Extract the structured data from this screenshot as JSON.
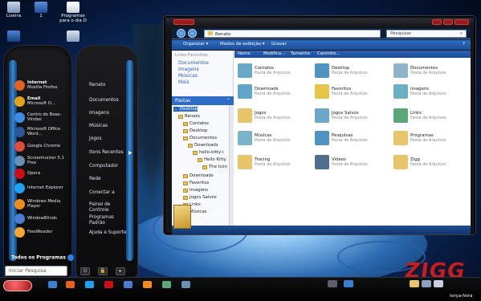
{
  "desktop": {
    "icons": [
      {
        "label": "Lixeira",
        "icon": "recycle-bin-icon"
      },
      {
        "label": "1",
        "icon": "computer-icon"
      },
      {
        "label": "Programas para o dia D",
        "icon": "document-icon"
      }
    ]
  },
  "start_menu": {
    "pinned": [
      {
        "title": "Internet",
        "subtitle": "Mozilla Firefox",
        "color": "#e4621b"
      },
      {
        "title": "Email",
        "subtitle": "Microsoft O...",
        "color": "#e3a21a"
      },
      {
        "title": "Centro de Boas-Vindas",
        "subtitle": "",
        "color": "#3a8ee6"
      },
      {
        "title": "Microsoft Office Word...",
        "subtitle": "",
        "color": "#2b579a"
      },
      {
        "title": "Google Chrome",
        "subtitle": "",
        "color": "#dd4b39"
      },
      {
        "title": "Screenhunter 5.1 Free",
        "subtitle": "",
        "color": "#6a8fb2"
      },
      {
        "title": "Opera",
        "subtitle": "",
        "color": "#cc0f16"
      },
      {
        "title": "Internet Explorer",
        "subtitle": "",
        "color": "#1ea1f1"
      },
      {
        "title": "Windows Media Player",
        "subtitle": "",
        "color": "#f28b1e"
      },
      {
        "title": "WindowBlinds",
        "subtitle": "",
        "color": "#4c7dd1"
      },
      {
        "title": "FeedReader",
        "subtitle": "",
        "color": "#f4a72b"
      }
    ],
    "all_programs": "Todos os Programas",
    "search_placeholder": "Iniciar Pesquisa",
    "links": [
      "Renato",
      "Documentos",
      "Imagens",
      "Músicas",
      "Jogos",
      "Itens Recentes",
      "Computador",
      "Rede",
      "Conectar a",
      "Painel de Controle",
      "Programas Padrão",
      "Ajuda e Suporte"
    ]
  },
  "explorer": {
    "address": "Renato",
    "search_placeholder": "Pesquisar",
    "toolbar": {
      "organize": "Organizar",
      "views": "Modos de exibição",
      "burn": "Gravar"
    },
    "favorites_header": "Links Favoritos",
    "favorites": [
      "Documentos",
      "Imagens",
      "Músicas",
      "Mais"
    ],
    "folders_header": "Pastas",
    "tree": [
      "Desktop",
      "Renato",
      "Contatos",
      "Desktop",
      "Documentos",
      "Downloads",
      "hello-kitty-i",
      "Hello Kitty",
      "The Icon",
      "Downloads",
      "Favoritos",
      "Imagens",
      "Jogos Salvos",
      "Links",
      "Músicas"
    ],
    "columns": [
      "Nome",
      "Modifica...",
      "Tamanho",
      "Caminho..."
    ],
    "items": [
      {
        "name": "Contatos",
        "sub": "Pasta de Arquivos",
        "color": "#6aa7c9"
      },
      {
        "name": "Desktop",
        "sub": "Pasta de Arquivos",
        "color": "#4f93c2"
      },
      {
        "name": "Documentos",
        "sub": "Pasta de Arquivos",
        "color": "#8fb3c9"
      },
      {
        "name": "Downloads",
        "sub": "Pasta de Arquivos",
        "color": "#5fa6c8"
      },
      {
        "name": "Favoritos",
        "sub": "Pasta de Arquivos",
        "color": "#e7c34a"
      },
      {
        "name": "Imagens",
        "sub": "Pasta de Arquivos",
        "color": "#6bb0c2"
      },
      {
        "name": "Jogos",
        "sub": "Pasta de Arquivos",
        "color": "#e8c46a"
      },
      {
        "name": "Jogos Salvos",
        "sub": "Pasta de Arquivos",
        "color": "#6aa7c9"
      },
      {
        "name": "Links",
        "sub": "Pasta de Arquivos",
        "color": "#5aa77a"
      },
      {
        "name": "Músicas",
        "sub": "Pasta de Arquivos",
        "color": "#7bb4c9"
      },
      {
        "name": "Pesquisas",
        "sub": "Pasta de Arquivos",
        "color": "#4f93c2"
      },
      {
        "name": "Programas",
        "sub": "Pasta de Arquivos",
        "color": "#e8c46a"
      },
      {
        "name": "Tracing",
        "sub": "Pasta de Arquivos",
        "color": "#e8c46a"
      },
      {
        "name": "Vídeos",
        "sub": "Pasta de Arquivos",
        "color": "#4f6d8c"
      },
      {
        "name": "Zigg",
        "sub": "Pasta de Arquivos",
        "color": "#e8c46a"
      }
    ],
    "item_count": "15 itens"
  },
  "taskbar": {
    "clock_day": "terça-feira"
  },
  "watermark": "ZIGG"
}
